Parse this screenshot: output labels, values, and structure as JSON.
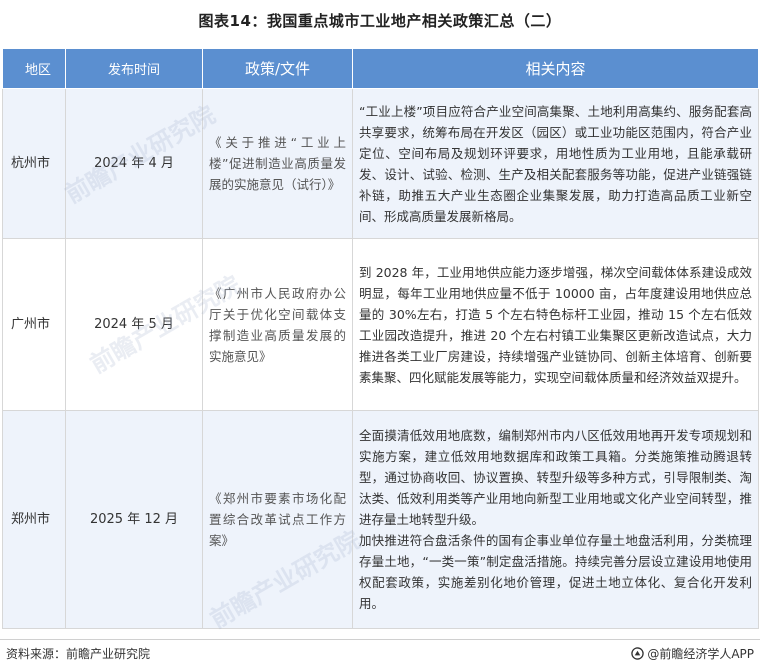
{
  "title": "图表14：我国重点城市工业地产相关政策汇总（二）",
  "table": {
    "headers": [
      "地区",
      "发布时间",
      "政策/文件",
      "相关内容"
    ],
    "rows": [
      {
        "region": "杭州市",
        "date": "2024 年 4 月",
        "policy": "《关于推进“工业上楼”促进制造业高质量发展的实施意见（试行）》",
        "content": "“工业上楼”项目应符合产业空间高集聚、土地利用高集约、服务配套高共享要求，统筹布局在开发区（园区）或工业功能区范围内，符合产业定位、空间布局及规划环评要求，用地性质为工业用地，且能承载研发、设计、试验、检测、生产及相关配套服务等功能，促进产业链强链补链，助推五大产业生态圈企业集聚发展，助力打造高品质工业新空间、形成高质量发展新格局。"
      },
      {
        "region": "广州市",
        "date": "2024 年 5 月",
        "policy": "《广州市人民政府办公厅关于优化空间载体支撑制造业高质量发展的实施意见》",
        "content": "到 2028 年，工业用地供应能力逐步增强，梯次空间载体体系建设成效明显，每年工业用地供应量不低于 10000 亩，占年度建设用地供应总量的 30%左右，打造 5 个左右特色标杆工业园，推动 15 个左右低效工业园改造提升，推进 20 个左右村镇工业集聚区更新改造试点，大力推进各类工业厂房建设，持续增强产业链协同、创新主体培育、创新要素集聚、四化赋能发展等能力，实现空间载体质量和经济效益双提升。"
      },
      {
        "region": "郑州市",
        "date": "2025 年 12 月",
        "policy": "《郑州市要素市场化配置综合改革试点工作方案》",
        "content": "全面摸清低效用地底数，编制郑州市内八区低效用地再开发专项规划和实施方案，建立低效用地数据库和政策工具箱。分类施策推动腾退转型，通过协商收回、协议置换、转型升级等多种方式，引导限制类、淘汰类、低效利用类等产业用地向新型工业用地或文化产业空间转型，推进存量土地转型升级。",
        "content2": "加快推进符合盘活条件的国有企事业单位存量土地盘活利用，分类梳理存量土地，“一类一策”制定盘活措施。持续完善分层设立建设用地使用权配套政策，实施差别化地价管理，促进土地立体化、复合化开发利用。"
      }
    ]
  },
  "footer": {
    "source": "资料来源：前瞻产业研究院",
    "brand": "@前瞻经济学人APP"
  },
  "colors": {
    "header_bg": "#5b8fd0",
    "odd_row_bg": "#eef3fb",
    "even_row_bg": "#ffffff"
  },
  "watermark": "前瞻产业研究院"
}
